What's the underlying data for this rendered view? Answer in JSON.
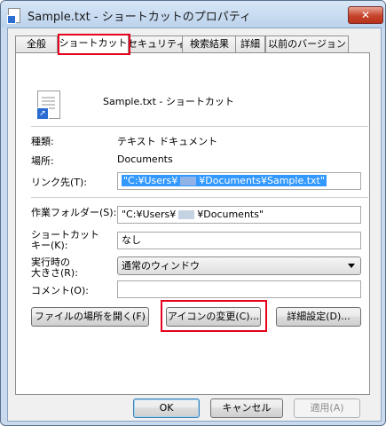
{
  "window": {
    "title": "Sample.txt - ショートカットのプロパティ",
    "close_label": "✕"
  },
  "tabs": [
    {
      "label": "全般"
    },
    {
      "label": "ショートカット"
    },
    {
      "label": "セキュリティ"
    },
    {
      "label": "検索結果"
    },
    {
      "label": "詳細"
    },
    {
      "label": "以前のバージョン"
    }
  ],
  "header": {
    "file_name": "Sample.txt - ショートカット",
    "icon": "text-file-shortcut-icon"
  },
  "info": {
    "type_label": "種類:",
    "type_value": "テキスト ドキュメント",
    "location_label": "場所:",
    "location_value": "Documents"
  },
  "form": {
    "target_label": "リンク先(T):",
    "target_value_prefix": "\"C:¥Users¥",
    "target_value_suffix": "¥Documents¥Sample.txt\"",
    "workdir_label": "作業フォルダー(S):",
    "workdir_value_prefix": "\"C:¥Users¥",
    "workdir_value_suffix": "¥Documents\"",
    "hotkey_label_1": "ショートカット",
    "hotkey_label_2": "キー(K):",
    "hotkey_value": "なし",
    "run_label_1": "実行時の",
    "run_label_2": "大きさ(R):",
    "run_value": "通常のウィンドウ",
    "comment_label": "コメント(O):",
    "comment_value": ""
  },
  "actions": {
    "open_location": "ファイルの場所を開く(F)",
    "change_icon": "アイコンの変更(C)...",
    "advanced": "詳細設定(D)..."
  },
  "footer": {
    "ok": "OK",
    "cancel": "キャンセル",
    "apply": "適用(A)"
  },
  "colors": {
    "highlight": "#e4001b",
    "selection": "#3399ff"
  }
}
